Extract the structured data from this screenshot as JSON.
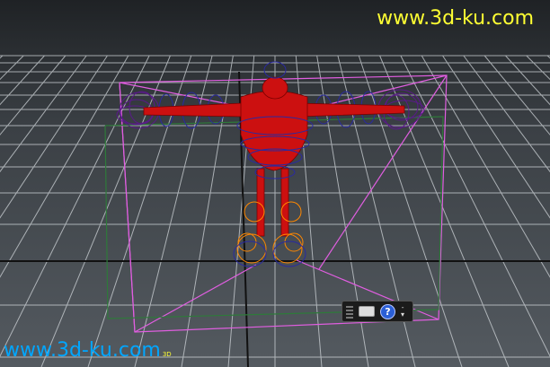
{
  "watermark": {
    "top": "www.3d-ku.com",
    "bottom": "www.3d-ku.com",
    "bottom_small": "3D"
  },
  "hud": {
    "help_glyph": "?",
    "minus_glyph": "-",
    "arrow_glyph": "▾"
  },
  "colors": {
    "grid": "#cfd4d8",
    "bbox": "#e05ee0",
    "body": "#d01010",
    "controls": "#2a2aa0",
    "hands": "#5a1a8a",
    "joints": "#ff8800"
  }
}
